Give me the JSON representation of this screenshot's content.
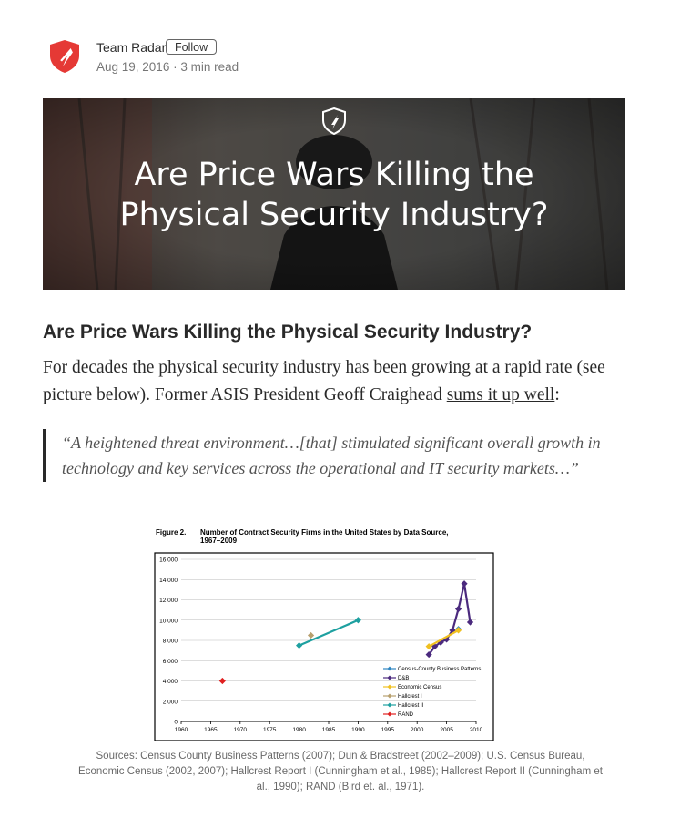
{
  "author": {
    "name": "Team Radar",
    "follow_label": "Follow",
    "date": "Aug 19, 2016",
    "separator": "·",
    "read_time": "3 min read"
  },
  "hero": {
    "title_line1": "Are Price Wars Killing the",
    "title_line2": "Physical Security Industry?"
  },
  "article": {
    "heading": "Are Price Wars Killing the Physical Security Industry?",
    "para_part1": "For decades the physical security industry has been growing at a rapid rate (see picture below). Former ASIS President Geoff Craighead ",
    "para_link": "sums it up well",
    "para_part2": ":",
    "quote": "“A heightened threat environment…[that] stimulated significant overall growth in technology and key services across the operational and IT security markets…”"
  },
  "figure": {
    "label": "Figure 2.",
    "title_line1": "Number of Contract Security Firms in the United States by Data Source,",
    "title_line2": "1967–2009",
    "caption": "Sources: Census County Business Patterns (2007); Dun & Bradstreet (2002–2009); U.S. Census Bureau, Economic Census (2002, 2007); Hallcrest Report I (Cunningham et al., 1985); Hallcrest Report II (Cunningham et al., 1990); RAND (Bird et. al., 1971)."
  },
  "chart_data": {
    "type": "line",
    "title": "Number of Contract Security Firms in the United States by Data Source, 1967–2009",
    "xlabel": "",
    "ylabel": "",
    "xlim": [
      1960,
      2010
    ],
    "ylim": [
      0,
      16000
    ],
    "xticks": [
      "1960",
      "1965",
      "1970",
      "1975",
      "1980",
      "1985",
      "1990",
      "1995",
      "2000",
      "2005",
      "2010"
    ],
    "yticks": [
      "0",
      "2,000",
      "4,000",
      "6,000",
      "8,000",
      "10,000",
      "12,000",
      "14,000",
      "16,000"
    ],
    "grid": true,
    "legend_position": "lower-right",
    "series": [
      {
        "name": "Census-County Business Patterns",
        "color": "#2e86c1",
        "marker": "diamond",
        "points": [
          [
            2007,
            9100
          ]
        ]
      },
      {
        "name": "D&B",
        "color": "#4b2a7e",
        "marker": "diamond",
        "points": [
          [
            2002,
            6600
          ],
          [
            2003,
            7400
          ],
          [
            2004,
            7800
          ],
          [
            2005,
            8100
          ],
          [
            2006,
            9000
          ],
          [
            2007,
            11100
          ],
          [
            2008,
            13600
          ],
          [
            2009,
            9800
          ]
        ]
      },
      {
        "name": "Economic Census",
        "color": "#f0c020",
        "marker": "diamond",
        "points": [
          [
            2002,
            7400
          ],
          [
            2007,
            9000
          ]
        ]
      },
      {
        "name": "Hallcrest I",
        "color": "#b8a06e",
        "marker": "diamond",
        "points": [
          [
            1982,
            8500
          ]
        ]
      },
      {
        "name": "Hallcrest II",
        "color": "#1ea0a0",
        "marker": "diamond",
        "points": [
          [
            1980,
            7500
          ],
          [
            1990,
            10000
          ]
        ]
      },
      {
        "name": "RAND",
        "color": "#e02020",
        "marker": "diamond",
        "points": [
          [
            1967,
            4000
          ]
        ]
      }
    ]
  }
}
